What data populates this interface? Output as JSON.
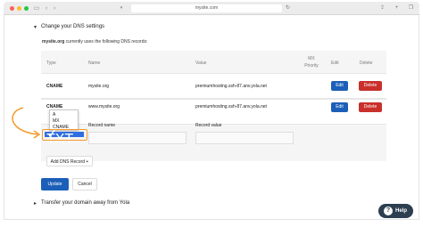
{
  "browser": {
    "url": "mysite.com",
    "colors": {
      "close": "#fd5f57",
      "minimize": "#febc2e",
      "maximize": "#28c840"
    }
  },
  "dns_section": {
    "toggle": "▾",
    "title": "Change your DNS settings",
    "intro_domain": "mysite.org",
    "intro_text": " currently uses the following DNS records:",
    "headers": {
      "type": "Type",
      "name": "Name",
      "value": "Value",
      "mx_priority_line1": "MX",
      "mx_priority_line2": "Priority",
      "edit": "Edit",
      "delete": "Delete"
    },
    "records": [
      {
        "type": "CNAME",
        "name": "mysite.org",
        "value": "premiumhosting.ssh-87.anv.yola.net",
        "edit_label": "Edit",
        "delete_label": "Delete"
      },
      {
        "type": "CNAME",
        "name": "www.mysite.org",
        "value": "premiumhosting.ssh-87.anv.yola.net",
        "edit_label": "Edit",
        "delete_label": "Delete"
      }
    ],
    "type_dropdown": {
      "options": [
        "A",
        "MX",
        "CNAME",
        "TXT"
      ],
      "selected": "TXT"
    },
    "new_record": {
      "record_name_label": "Record name",
      "record_value_label": "Record value",
      "record_name_value": "",
      "record_value_value": ""
    },
    "add_button": "Add DNS Record +",
    "update_button": "Update",
    "cancel_button": "Cancel"
  },
  "transfer_section": {
    "toggle": "▸",
    "title": "Transfer your domain away from Yola"
  },
  "help": {
    "label": "Help",
    "icon": "?"
  },
  "colors": {
    "primary": "#1c5fb8",
    "danger": "#c9302c",
    "highlight": "#f39b2d",
    "help_bg": "#2c3e50"
  }
}
